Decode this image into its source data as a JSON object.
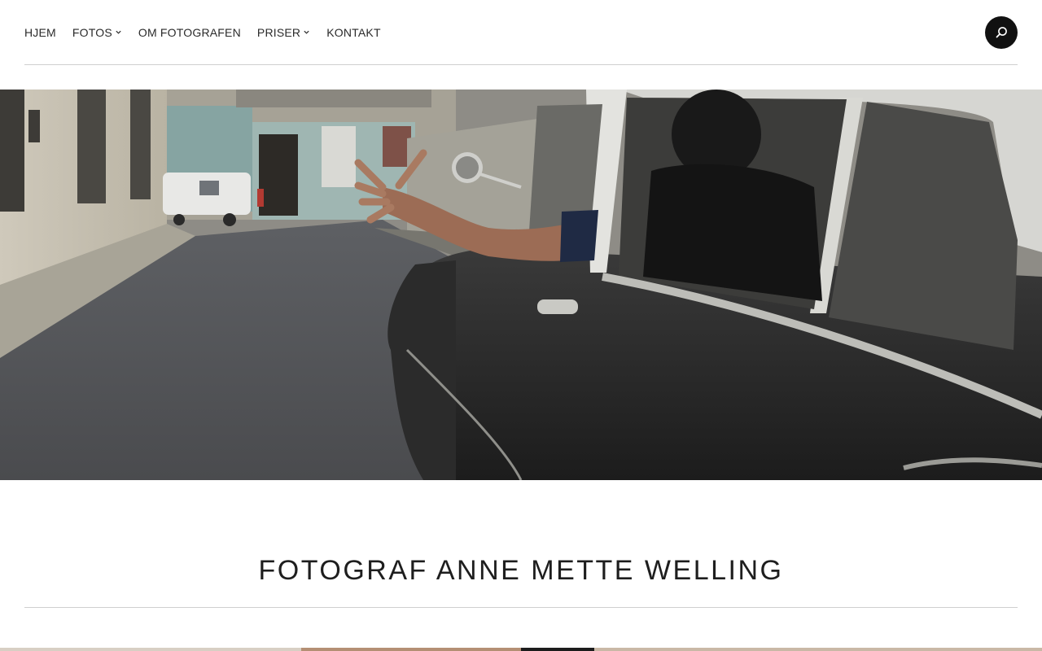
{
  "nav": {
    "items": [
      {
        "label": "HJEM",
        "has_dropdown": false
      },
      {
        "label": "FOTOS",
        "has_dropdown": true
      },
      {
        "label": "OM FOTOGRAFEN",
        "has_dropdown": false
      },
      {
        "label": "PRISER",
        "has_dropdown": true
      },
      {
        "label": "KONTAKT",
        "has_dropdown": false
      }
    ]
  },
  "search": {
    "icon": "search-icon"
  },
  "site_title": "FOTOGRAF ANNE METTE WELLING",
  "colors": {
    "text": "#222222",
    "divider": "#cfcfcf",
    "search_button": "#111111"
  }
}
